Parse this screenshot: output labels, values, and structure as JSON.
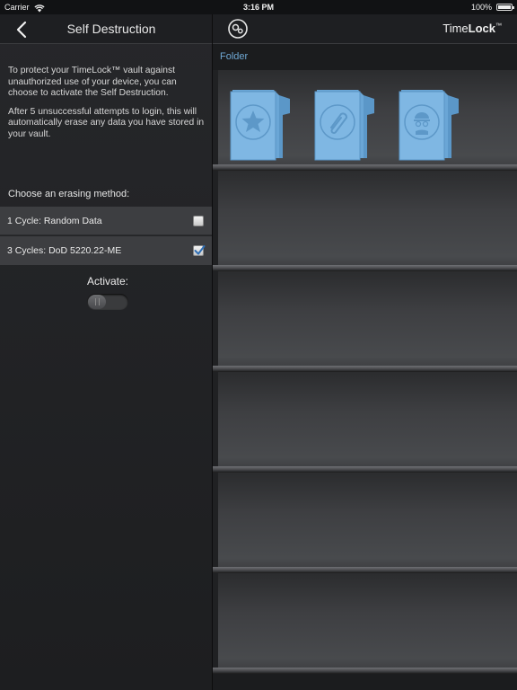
{
  "status_bar": {
    "carrier": "Carrier",
    "time": "3:16 PM",
    "battery": "100%"
  },
  "left_panel": {
    "title": "Self Destruction",
    "intro_paragraph_1": "To protect your TimeLock™ vault against unauthorized use of your device, you can choose to activate the Self Destruction.",
    "intro_paragraph_2": "After 5 unsuccessful attempts to login, this will automatically erase any data you have stored in your vault.",
    "erase_heading": "Choose an erasing method:",
    "options": [
      {
        "label": "1 Cycle: Random Data",
        "checked": false
      },
      {
        "label": "3 Cycles: DoD 5220.22-ME",
        "checked": true
      }
    ],
    "activate_label": "Activate:",
    "activate_on": false
  },
  "right_panel": {
    "brand_light": "Time",
    "brand_bold": "Lock",
    "brand_tm": "™",
    "folder_label": "Folder",
    "folders": [
      {
        "icon": "star-icon"
      },
      {
        "icon": "paperclip-icon"
      },
      {
        "icon": "person-icon"
      }
    ],
    "shelf_count": 6
  },
  "colors": {
    "accent_blue": "#6fa8d4",
    "folder_blue": "#7fb7e3",
    "checkmark_blue": "#2f6fb6"
  }
}
